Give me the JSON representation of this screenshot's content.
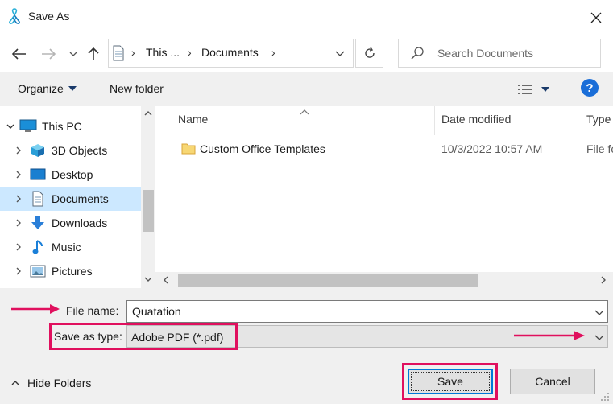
{
  "window": {
    "title": "Save As",
    "title_icon": "pdf-app-icon"
  },
  "address_bar": {
    "crumbs": [
      "This ...",
      "Documents"
    ],
    "separator": "›"
  },
  "search": {
    "placeholder": "Search Documents"
  },
  "toolbar": {
    "organize_label": "Organize",
    "new_folder_label": "New folder",
    "help_label": "?"
  },
  "nav_tree": {
    "items": [
      {
        "label": "This PC",
        "icon": "computer-icon",
        "expanded": true
      },
      {
        "label": "3D Objects",
        "icon": "cube-icon"
      },
      {
        "label": "Desktop",
        "icon": "desktop-icon"
      },
      {
        "label": "Documents",
        "icon": "document-icon",
        "selected": true
      },
      {
        "label": "Downloads",
        "icon": "download-arrow-icon"
      },
      {
        "label": "Music",
        "icon": "music-note-icon"
      },
      {
        "label": "Pictures",
        "icon": "picture-icon"
      }
    ]
  },
  "file_list": {
    "columns": [
      "Name",
      "Date modified",
      "Type"
    ],
    "rows": [
      {
        "name": "Custom Office Templates",
        "date_modified": "10/3/2022 10:57 AM",
        "type": "File fo"
      }
    ]
  },
  "form": {
    "file_name_label": "File name:",
    "file_name_value": "Quatation",
    "save_type_label": "Save as type:",
    "save_type_value": "Adobe PDF (*.pdf)"
  },
  "footer": {
    "hide_folders_label": "Hide Folders",
    "save_label": "Save",
    "cancel_label": "Cancel"
  },
  "colors": {
    "annotation": "#e0105e",
    "selection": "#cce8ff",
    "accent": "#0078d7"
  }
}
